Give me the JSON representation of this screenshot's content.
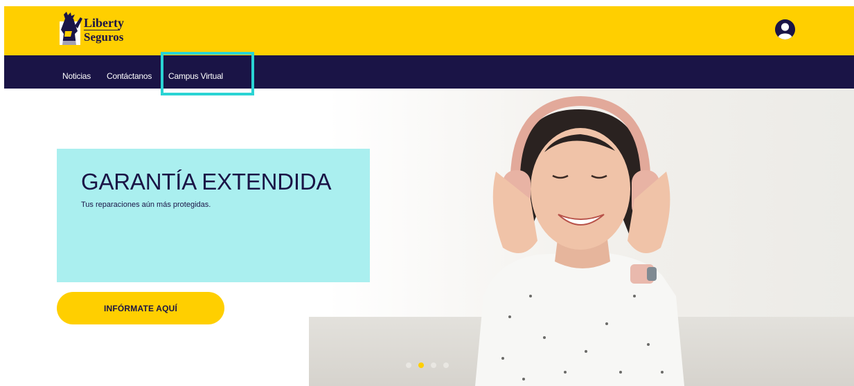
{
  "header": {
    "logo": {
      "line1": "Liberty",
      "line2": "Seguros"
    },
    "user_icon": "user-avatar-icon"
  },
  "nav": {
    "items": [
      {
        "label": "Noticias"
      },
      {
        "label": "Contáctanos"
      },
      {
        "label": "Campus Virtual"
      }
    ],
    "highlighted_item": "Campus Virtual"
  },
  "hero": {
    "title": "GARANTÍA EXTENDIDA",
    "subtitle": "Tus reparaciones aún más protegidas.",
    "cta_label": "INFÓRMATE AQUÍ",
    "carousel": {
      "total": 4,
      "active_index": 1
    }
  },
  "colors": {
    "brand_yellow": "#ffcf00",
    "brand_navy": "#1a1446",
    "card_cyan": "#aaefef",
    "highlight_teal": "#2ad4d4"
  }
}
